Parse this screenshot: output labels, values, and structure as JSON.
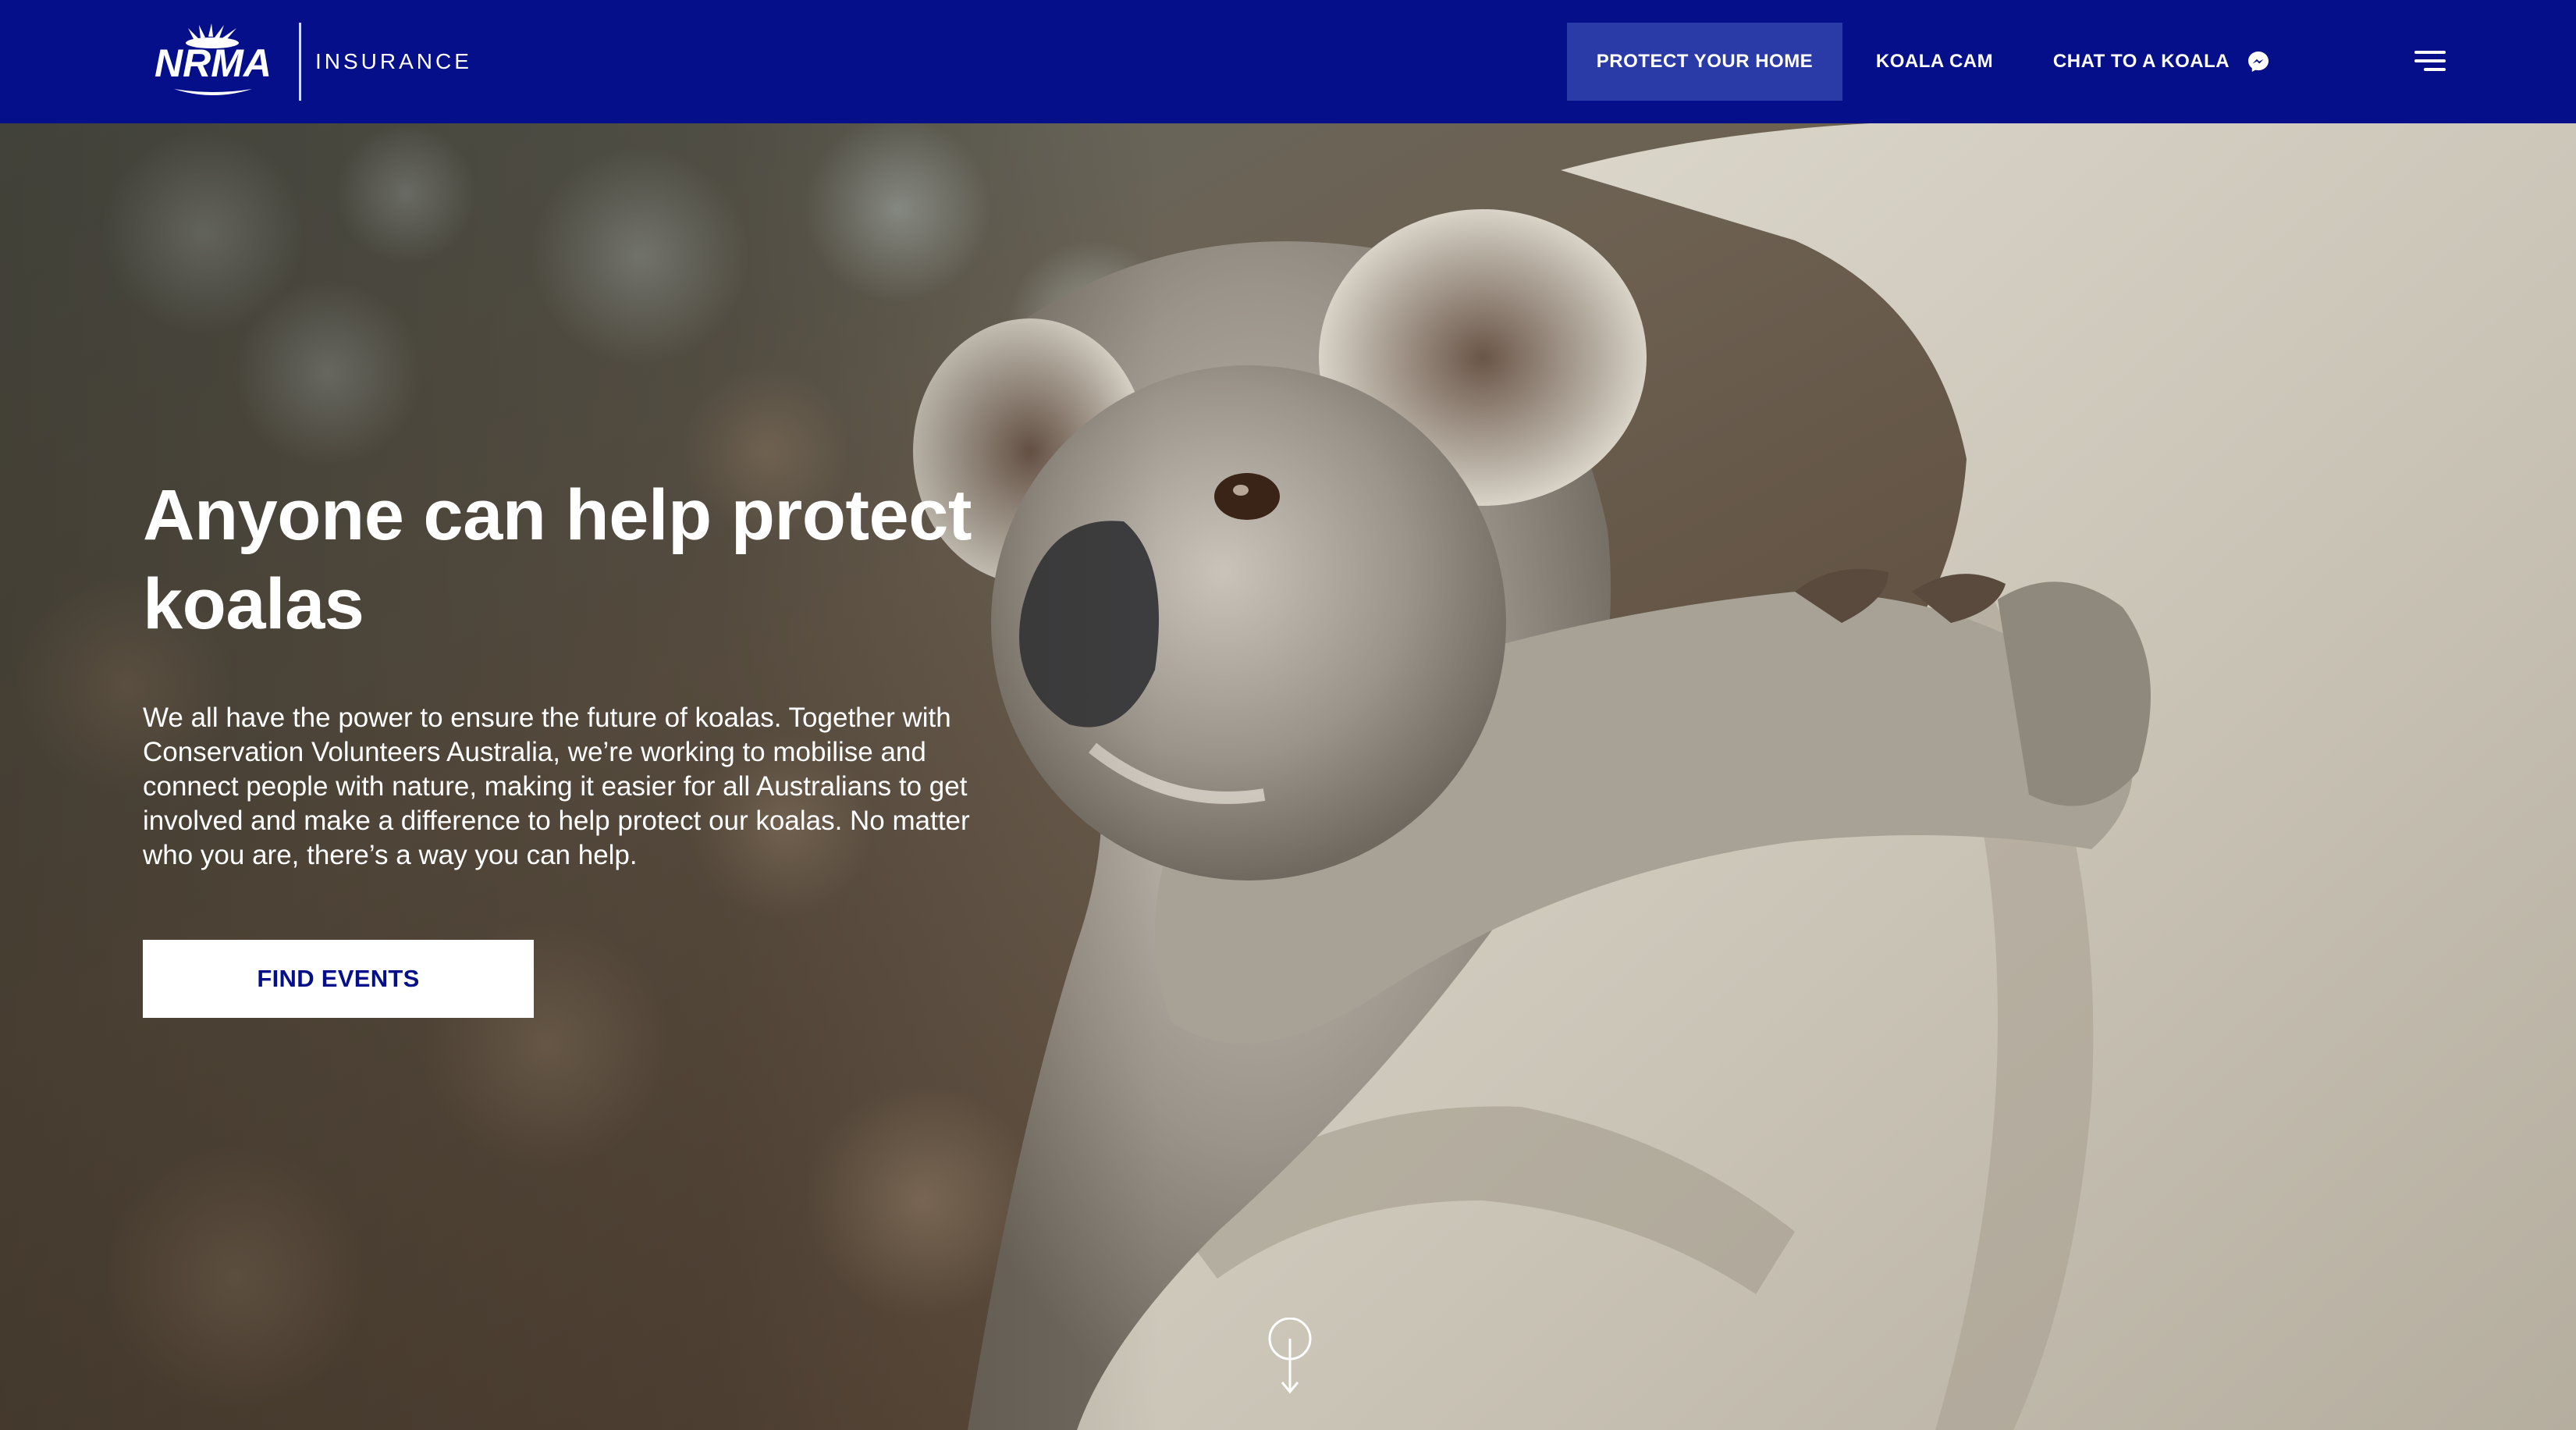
{
  "brand": {
    "name": "NRMA",
    "division": "INSURANCE",
    "color": "#050f8a"
  },
  "nav": {
    "protect_home": "PROTECT YOUR HOME",
    "koala_cam": "KOALA CAM",
    "chat_koala": "CHAT TO A KOALA",
    "chat_icon": "messenger-icon",
    "menu_icon": "hamburger-menu-icon",
    "active_bg": "#2a3aa6"
  },
  "hero": {
    "title": "Anyone can help protect koalas",
    "body": "We all have the power to ensure the future of koalas. Together with Conservation Volunteers Australia, we’re working to mobilise and connect people with nature, making it easier for all Australians to get involved and make a difference to help protect our koalas. No matter who you are, there’s a way you can help.",
    "cta": "FIND EVENTS",
    "scroll_icon": "scroll-down-icon"
  }
}
